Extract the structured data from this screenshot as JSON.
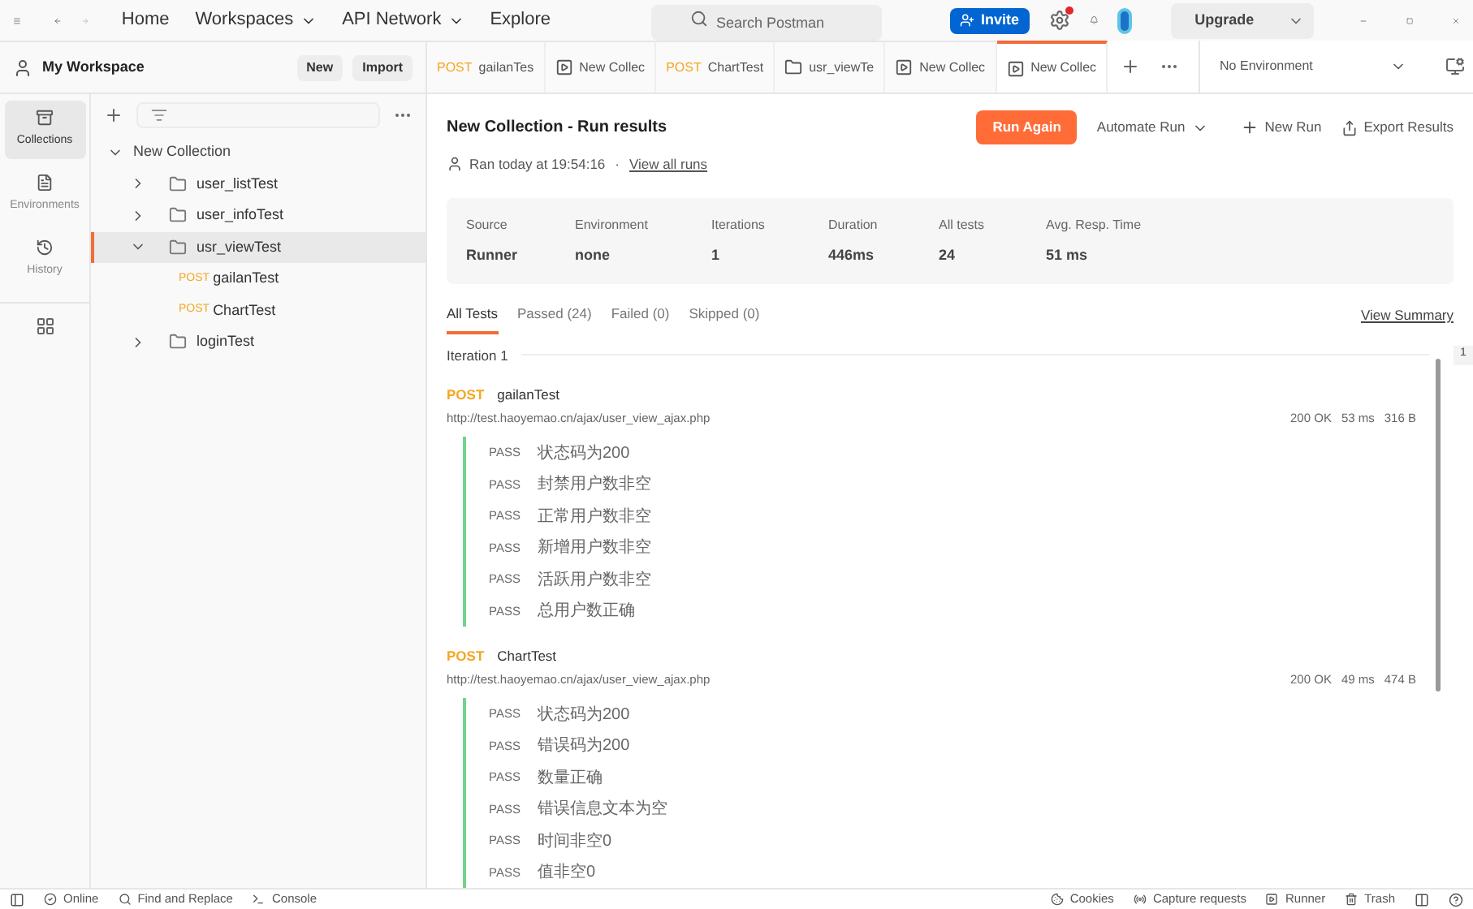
{
  "nav": {
    "items": [
      {
        "label": "Home",
        "dropdown": false
      },
      {
        "label": "Workspaces",
        "dropdown": true
      },
      {
        "label": "API Network",
        "dropdown": true
      },
      {
        "label": "Explore",
        "dropdown": false
      }
    ]
  },
  "search": {
    "placeholder": "Search Postman"
  },
  "invite_button": "Invite",
  "settings_alert": true,
  "upgrade_button": "Upgrade",
  "workspace": {
    "title": "My Workspace",
    "buttons": [
      "New",
      "Import"
    ]
  },
  "tabs": [
    {
      "kind": "request",
      "method": "POST",
      "label": "gailanTes",
      "selected": false
    },
    {
      "kind": "runner",
      "label": "New Collec",
      "selected": false
    },
    {
      "kind": "request",
      "method": "POST",
      "label": "ChartTest",
      "selected": false
    },
    {
      "kind": "folder",
      "label": "usr_viewTe",
      "selected": false
    },
    {
      "kind": "runner",
      "label": "New Collec",
      "selected": false
    },
    {
      "kind": "runner",
      "label": "New Collec",
      "selected": true
    }
  ],
  "environment": "No Environment",
  "rail": [
    {
      "label": "Collections",
      "selected": true
    },
    {
      "label": "Environments",
      "selected": false
    },
    {
      "label": "History",
      "selected": false
    }
  ],
  "tree": [
    {
      "kind": "collection",
      "label": "New Collection",
      "expanded": true,
      "selected": false,
      "children": [
        {
          "kind": "folder",
          "label": "user_listTest",
          "expanded": false,
          "selected": false
        },
        {
          "kind": "folder",
          "label": "user_infoTest",
          "expanded": false,
          "selected": false
        },
        {
          "kind": "folder",
          "label": "usr_viewTest",
          "expanded": true,
          "selected": true,
          "children": [
            {
              "kind": "request",
              "method": "POST",
              "label": "gailanTest",
              "selected": false
            },
            {
              "kind": "request",
              "method": "POST",
              "label": "ChartTest",
              "selected": false
            }
          ]
        },
        {
          "kind": "folder",
          "label": "loginTest",
          "expanded": false,
          "selected": false
        }
      ]
    }
  ],
  "run": {
    "title": "New Collection - Run results",
    "ran": "Ran today at 19:54:16",
    "separator": "·",
    "view_all": "View all runs",
    "actions": {
      "run_again": "Run Again",
      "automate": "Automate Run",
      "new_run": "New Run",
      "export": "Export Results"
    },
    "stats": [
      {
        "label": "Source",
        "value": "Runner"
      },
      {
        "label": "Environment",
        "value": "none"
      },
      {
        "label": "Iterations",
        "value": "1"
      },
      {
        "label": "Duration",
        "value": "446ms"
      },
      {
        "label": "All tests",
        "value": "24"
      },
      {
        "label": "Avg. Resp. Time",
        "value": "51 ms"
      }
    ],
    "filters": [
      {
        "label": "All Tests",
        "selected": true
      },
      {
        "label": "Passed (24)",
        "selected": false
      },
      {
        "label": "Failed (0)",
        "selected": false
      },
      {
        "label": "Skipped (0)",
        "selected": false
      }
    ],
    "view_summary": "View Summary",
    "iteration": "Iteration 1",
    "scroll_marker": "1",
    "requests": [
      {
        "method": "POST",
        "name": "gailanTest",
        "url": "http://test.haoyemao.cn/ajax/user_view_ajax.php",
        "status": "200 OK",
        "time": "53 ms",
        "size": "316 B",
        "tests": [
          {
            "result": "PASS",
            "name": "状态码为200"
          },
          {
            "result": "PASS",
            "name": "封禁用户数非空"
          },
          {
            "result": "PASS",
            "name": "正常用户数非空"
          },
          {
            "result": "PASS",
            "name": "新增用户数非空"
          },
          {
            "result": "PASS",
            "name": "活跃用户数非空"
          },
          {
            "result": "PASS",
            "name": "总用户数正确"
          }
        ]
      },
      {
        "method": "POST",
        "name": "ChartTest",
        "url": "http://test.haoyemao.cn/ajax/user_view_ajax.php",
        "status": "200 OK",
        "time": "49 ms",
        "size": "474 B",
        "tests": [
          {
            "result": "PASS",
            "name": "状态码为200"
          },
          {
            "result": "PASS",
            "name": "错误码为200"
          },
          {
            "result": "PASS",
            "name": "数量正确"
          },
          {
            "result": "PASS",
            "name": "错误信息文本为空"
          },
          {
            "result": "PASS",
            "name": "时间非空0"
          },
          {
            "result": "PASS",
            "name": "值非空0"
          }
        ]
      }
    ]
  },
  "status_bar": {
    "left": [
      "Online",
      "Find and Replace",
      "Console"
    ],
    "right": [
      "Cookies",
      "Capture requests",
      "Runner",
      "Trash"
    ]
  }
}
